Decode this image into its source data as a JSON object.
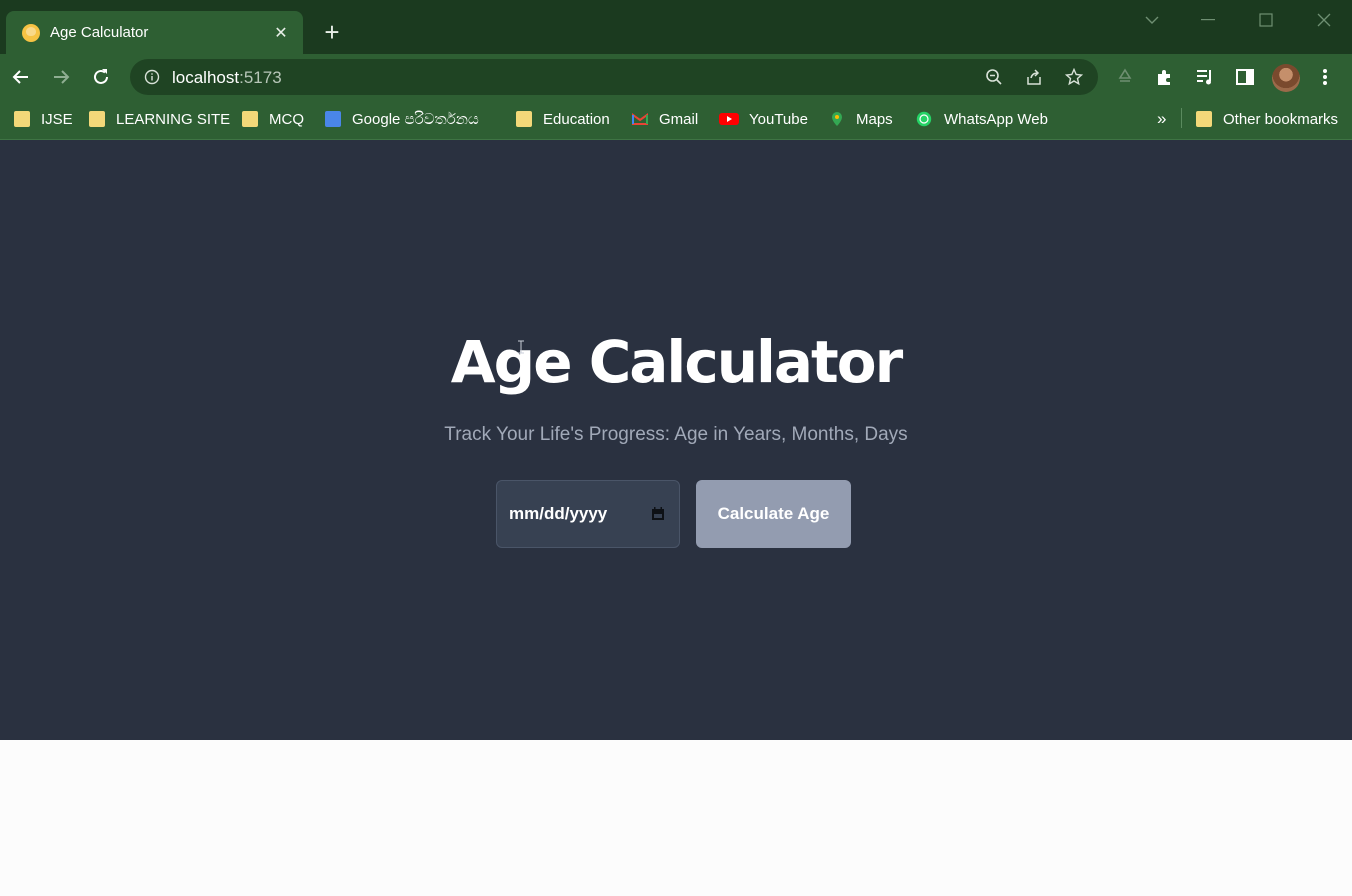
{
  "browser": {
    "tab": {
      "title": "Age Calculator",
      "close": "✕"
    },
    "new_tab": "+",
    "url": {
      "host": "localhost",
      "port": ":5173"
    },
    "bookmarks": [
      {
        "label": "IJSE",
        "icon": "folder-icon"
      },
      {
        "label": "LEARNING SITE",
        "icon": "folder-icon"
      },
      {
        "label": "MCQ",
        "icon": "folder-icon"
      },
      {
        "label": "Google පරිවර්තනය",
        "icon": "google-translate-icon"
      },
      {
        "label": "Education",
        "icon": "folder-icon"
      },
      {
        "label": "Gmail",
        "icon": "gmail-icon"
      },
      {
        "label": "YouTube",
        "icon": "youtube-icon"
      },
      {
        "label": "Maps",
        "icon": "maps-icon"
      },
      {
        "label": "WhatsApp Web",
        "icon": "whatsapp-icon"
      }
    ],
    "overflow": "»",
    "other_bookmarks": "Other bookmarks"
  },
  "page": {
    "title": "Age Calculator",
    "subtitle": "Track Your Life's Progress: Age in Years, Months, Days",
    "date_input": {
      "placeholder": "mm/dd/yyyy"
    },
    "button": "Calculate Age"
  },
  "colors": {
    "chrome_dark": "#1b3a1f",
    "chrome": "#2e5f33",
    "page_bg": "#2a3140",
    "button_bg": "#939cb0"
  }
}
